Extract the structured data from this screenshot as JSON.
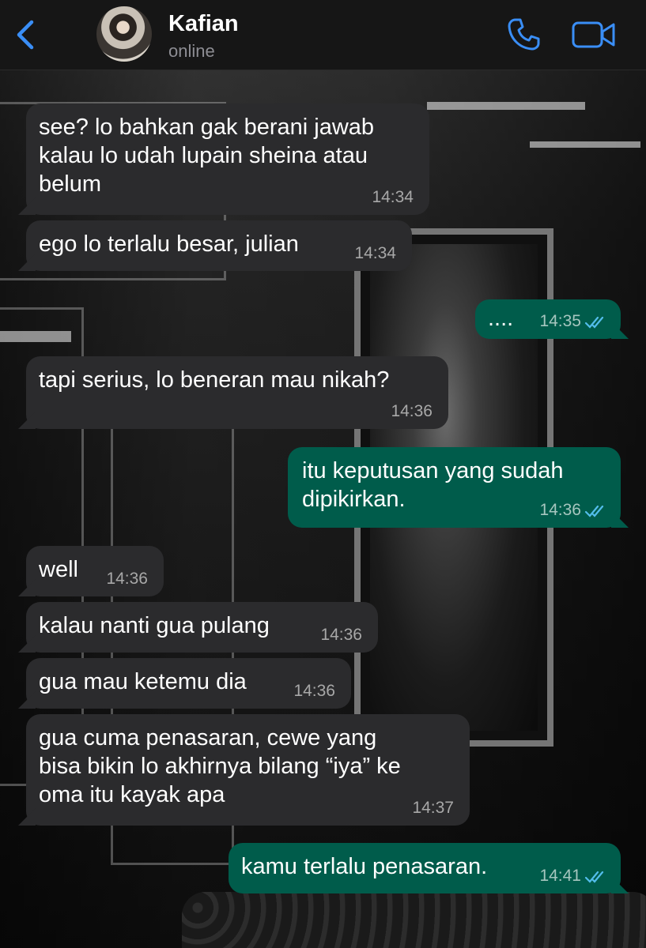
{
  "header": {
    "contact_name": "Kafian",
    "status": "online",
    "accent_color": "#3a8ef6",
    "icons": [
      "back-chevron-icon",
      "phone-icon",
      "video-camera-icon"
    ]
  },
  "messages": [
    {
      "direction": "in",
      "text": "see? lo bahkan gak berani jawab\nkalau lo udah lupain sheina atau\nbelum",
      "time": "14:34"
    },
    {
      "direction": "in",
      "text": "ego lo terlalu besar, julian",
      "time": "14:34"
    },
    {
      "direction": "out",
      "text": "....",
      "time": "14:35",
      "read": true
    },
    {
      "direction": "in",
      "text": "tapi serius, lo beneran mau nikah?",
      "time": "14:36"
    },
    {
      "direction": "out",
      "text": "itu keputusan yang sudah\ndipikirkan.",
      "time": "14:36",
      "read": true
    },
    {
      "direction": "in",
      "text": "well",
      "time": "14:36"
    },
    {
      "direction": "in",
      "text": "kalau nanti gua pulang",
      "time": "14:36"
    },
    {
      "direction": "in",
      "text": "gua mau ketemu dia",
      "time": "14:36"
    },
    {
      "direction": "in",
      "text": "gua cuma penasaran, cewe yang\nbisa bikin lo akhirnya bilang “iya” ke\noma itu kayak apa",
      "time": "14:37"
    },
    {
      "direction": "out",
      "text": "kamu terlalu penasaran.",
      "time": "14:41",
      "read": true
    }
  ],
  "colors": {
    "incoming_bubble": "#2b2b2d",
    "outgoing_bubble": "#005c4b",
    "read_ticks": "#53bdeb"
  }
}
